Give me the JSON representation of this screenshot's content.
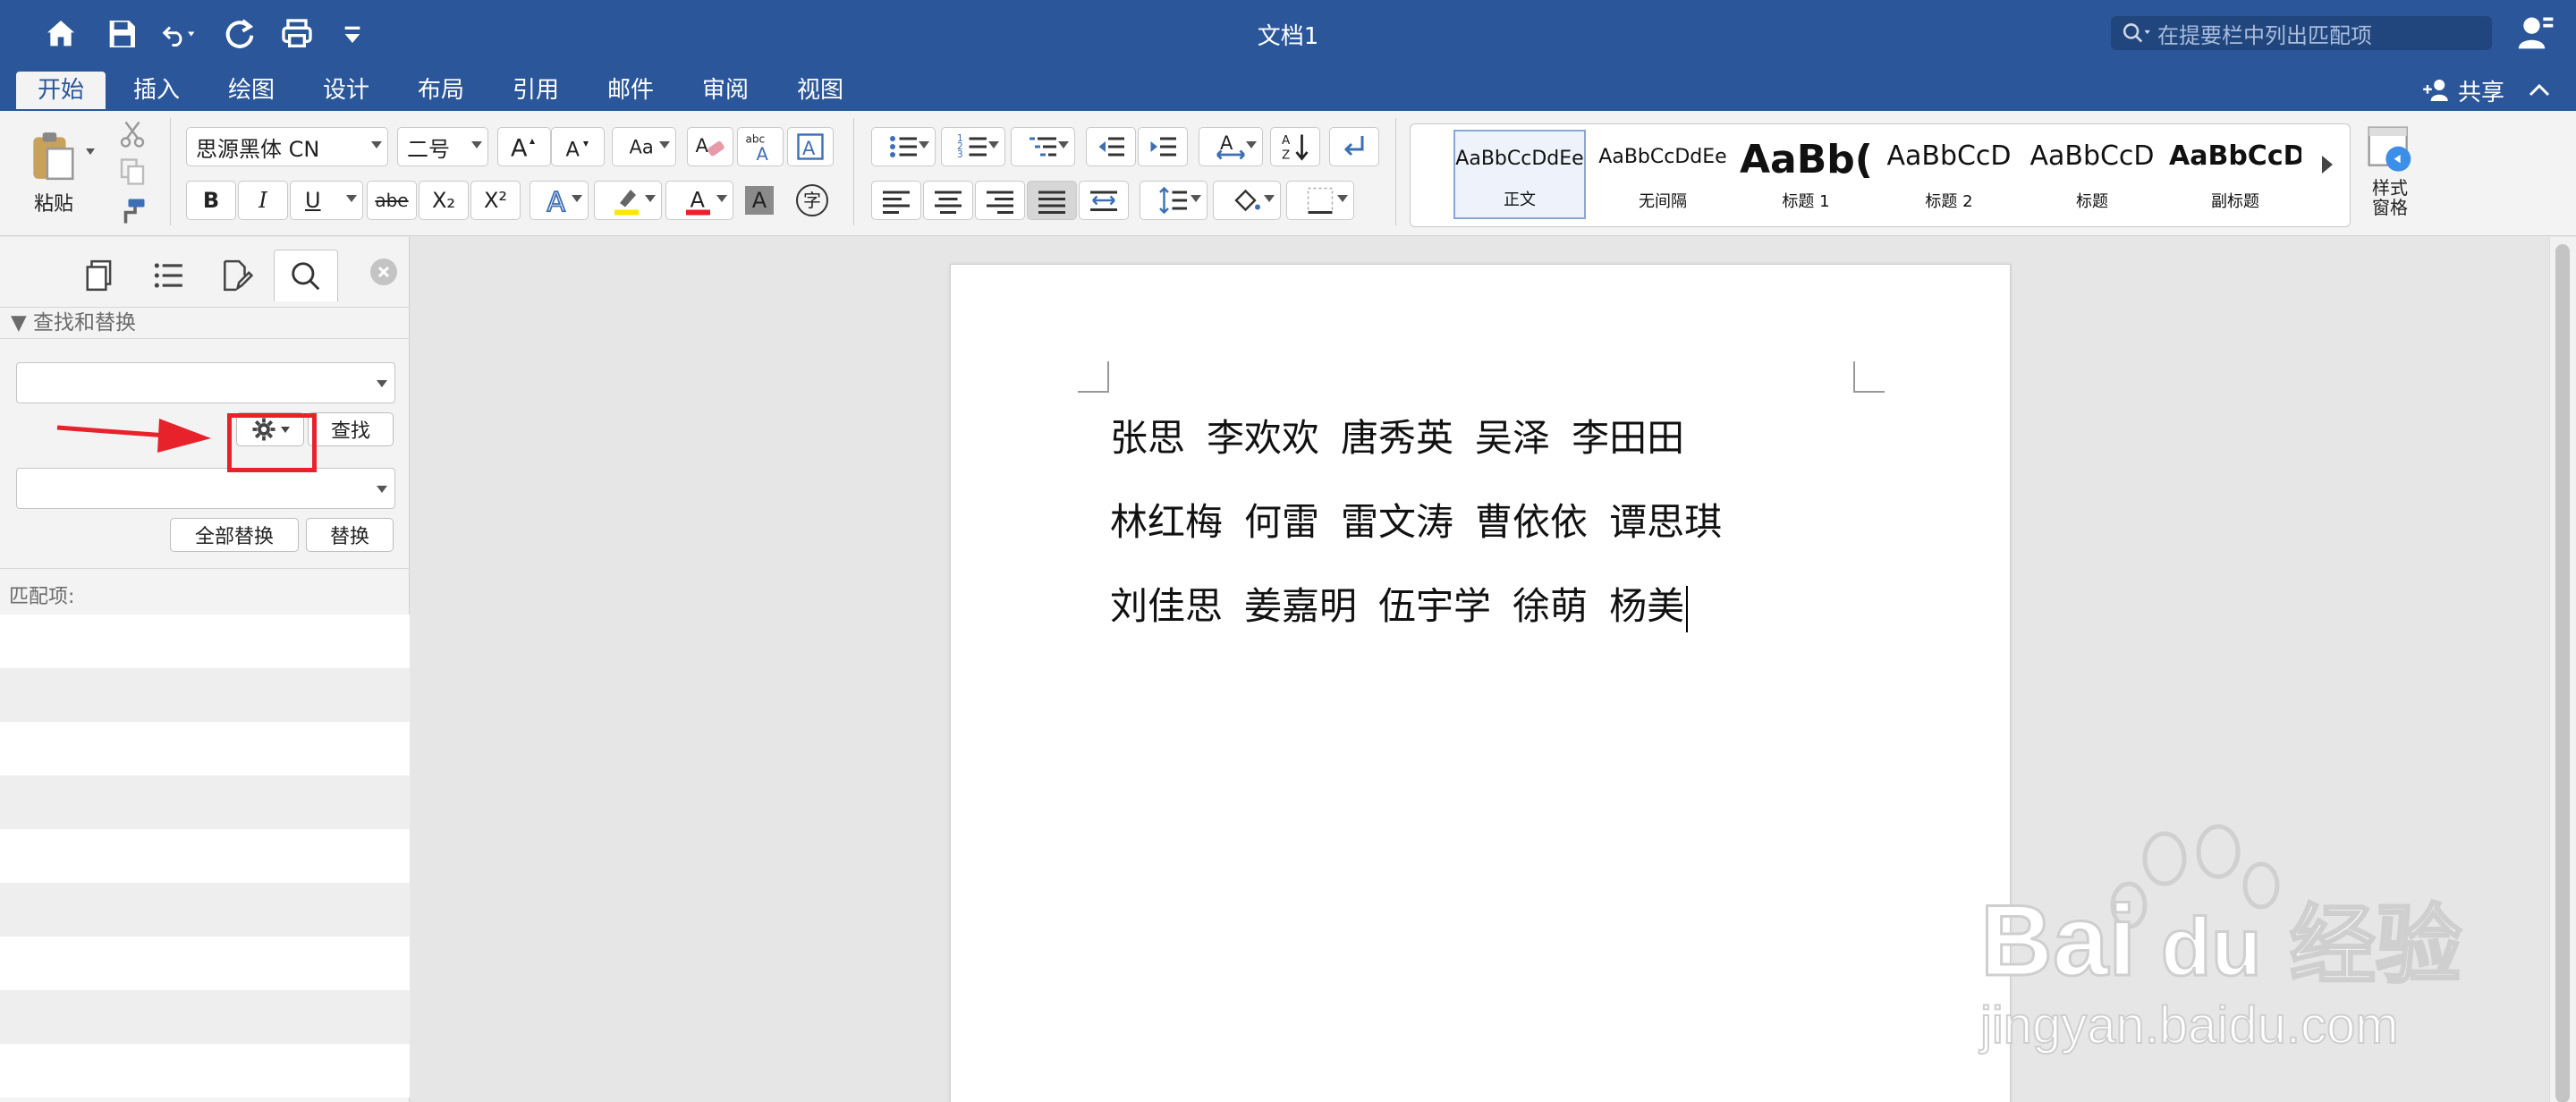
{
  "title_bar": {
    "doc_title": "文档1",
    "search_placeholder": "在提要栏中列出匹配项"
  },
  "tabs": [
    "开始",
    "插入",
    "绘图",
    "设计",
    "布局",
    "引用",
    "邮件",
    "审阅",
    "视图"
  ],
  "share_label": "共享",
  "ribbon": {
    "paste_label": "粘贴",
    "font_name": "思源黑体 CN",
    "font_size": "二号",
    "styles": [
      {
        "sample": "AaBbCcDdEe",
        "name": "正文"
      },
      {
        "sample": "AaBbCcDdEe",
        "name": "无间隔"
      },
      {
        "sample": "AaBb(",
        "name": "标题 1"
      },
      {
        "sample": "AaBbCcD",
        "name": "标题 2"
      },
      {
        "sample": "AaBbCcD",
        "name": "标题"
      },
      {
        "sample": "AaBbCcD",
        "name": "副标题"
      }
    ],
    "styles_pane_label": "样式\n窗格",
    "bold_label": "B",
    "italic_label": "I",
    "underline_label": "U",
    "strike_label": "abe",
    "sub_label": "X₂",
    "sup_label": "X²",
    "char_shading_label": "A",
    "phonetic_label": "字"
  },
  "sidebar": {
    "find_replace_header": "▼ 查找和替换",
    "find_button": "查找",
    "replace_all_button": "全部替换",
    "replace_button": "替换",
    "matches_label": "匹配项:"
  },
  "document": {
    "lines": [
      [
        "张思",
        "李欢欢",
        "唐秀英",
        "吴泽",
        "李田田"
      ],
      [
        "林红梅",
        "何雷",
        "雷文涛",
        "曹依依",
        "谭思琪"
      ],
      [
        "刘佳思",
        "姜嘉明",
        "伍宇学",
        "徐萌",
        "杨美"
      ]
    ]
  },
  "watermark": {
    "text": "Baidu经验",
    "url": "jingyan.baidu.com"
  },
  "colors": {
    "accent": "#2b579a",
    "highlight": "#e8222b"
  }
}
